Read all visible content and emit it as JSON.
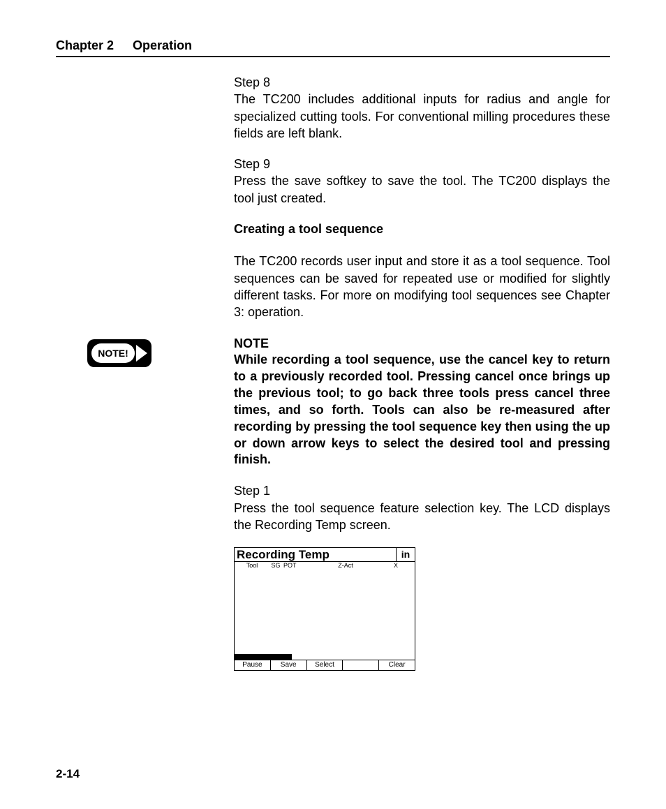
{
  "header": {
    "chapter": "Chapter 2",
    "title": "Operation"
  },
  "steps": {
    "s8": {
      "label": "Step 8",
      "text": "The TC200 includes additional inputs for radius and angle for specialized cutting tools.  For conventional milling procedures these fields are left blank."
    },
    "s9": {
      "label": "Step 9",
      "text": "Press the save softkey to save the tool.  The TC200 displays the tool just created."
    },
    "s1": {
      "label": "Step 1",
      "text": "Press the tool sequence feature selection key.  The LCD displays the Recording Temp screen."
    }
  },
  "section_heading": "Creating a tool sequence",
  "section_intro": "The TC200 records user input and store it as a tool sequence.  Tool sequences can be saved for repeated use or modified for slightly different tasks.  For more on modifying tool sequences see Chapter 3: operation.",
  "note": {
    "icon_label": "NOTE!",
    "title": "NOTE",
    "body": "While recording a tool sequence, use the cancel key to return to a previously recorded tool.  Pressing cancel once brings up the previous tool; to go back three tools press cancel three times, and so forth.  Tools can also be re-measured after recording by pressing the tool sequence key then using the up or down arrow keys to select the desired tool and pressing finish."
  },
  "lcd": {
    "title": "Recording Temp",
    "unit": "in",
    "columns": {
      "tool": "Tool",
      "sg": "SG",
      "pot": "POT",
      "zact": "Z-Act",
      "x": "X"
    },
    "softkeys": {
      "k1": "Pause",
      "k2": "Save",
      "k3": "Select",
      "k4": "",
      "k5": "Clear"
    }
  },
  "page_number": "2-14"
}
